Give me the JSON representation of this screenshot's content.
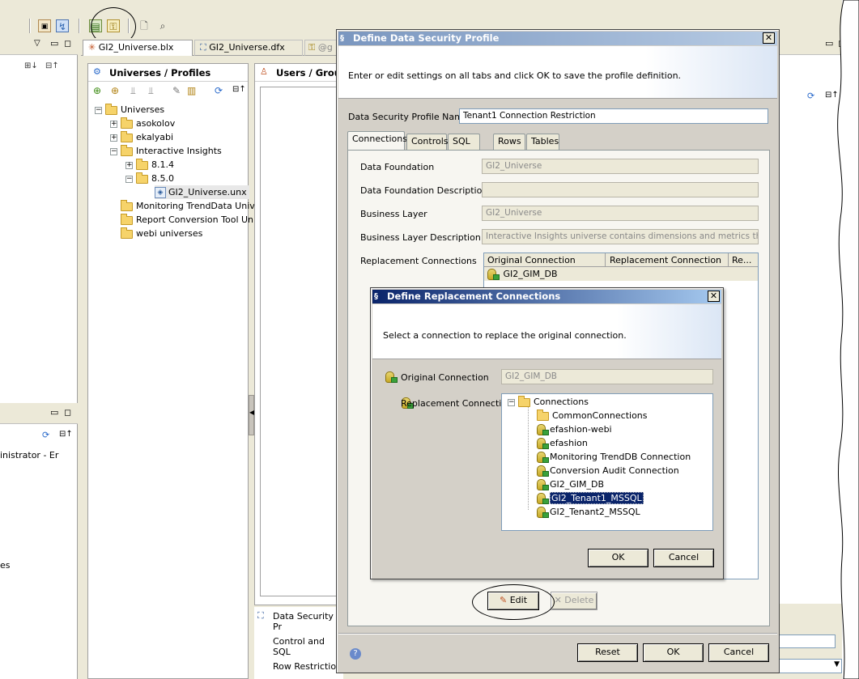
{
  "editor_tabs": [
    "GI2_Universe.blx",
    "GI2_Universe.dfx",
    "@g"
  ],
  "universes_panel": {
    "title": "Universes / Profiles",
    "tree": [
      {
        "label": "Universes",
        "level": 0,
        "expander": "-"
      },
      {
        "label": "asokolov",
        "level": 1,
        "expander": "+"
      },
      {
        "label": "ekalyabi",
        "level": 1,
        "expander": "+"
      },
      {
        "label": "Interactive Insights",
        "level": 1,
        "expander": "-"
      },
      {
        "label": "8.1.4",
        "level": 2,
        "expander": "+"
      },
      {
        "label": "8.5.0",
        "level": 2,
        "expander": "-"
      },
      {
        "label": "GI2_Universe.unx",
        "level": 3,
        "expander": ""
      },
      {
        "label": "Monitoring TrendData Unive",
        "level": 1,
        "expander": ""
      },
      {
        "label": "Report Conversion Tool Univ",
        "level": 1,
        "expander": ""
      },
      {
        "label": "webi universes",
        "level": 1,
        "expander": ""
      }
    ]
  },
  "users_panel": {
    "title": "Users / Group"
  },
  "left_panel": {
    "partial_text": "inistrator - Er",
    "partial_text2": "es"
  },
  "bottom_section": {
    "data_security_label": "Data Security Pr",
    "control_sql_label": "Control and SQL",
    "row_restriction_label": "Row Restriction"
  },
  "dsp_dialog": {
    "title": "Define Data Security Profile",
    "instructions": "Enter or edit settings on all tabs and click OK to save the profile definition.",
    "name_label": "Data Security Profile Name",
    "name_value": "Tenant1 Connection Restriction",
    "tabs": [
      "Connections",
      "Controls",
      "SQL",
      "Rows",
      "Tables"
    ],
    "fields": {
      "data_foundation_label": "Data Foundation",
      "data_foundation_value": "GI2_Universe",
      "df_description_label": "Data Foundation Description",
      "df_description_value": "",
      "business_layer_label": "Business Layer",
      "business_layer_value": "GI2_Universe",
      "bl_description_label": "Business Layer Description",
      "bl_description_value": "Interactive Insights universe contains dimensions and metrics that car",
      "replacement_label": "Replacement Connections"
    },
    "replacement_table": {
      "columns": [
        "Original Connection",
        "Replacement Connection",
        "Re..."
      ],
      "row_value": "GI2_GIM_DB"
    },
    "edit_button": "Edit",
    "delete_button": "Delete",
    "reset_button": "Reset",
    "ok_button": "OK",
    "cancel_button": "Cancel"
  },
  "drc_dialog": {
    "title": "Define Replacement Connections",
    "instructions": "Select a connection to replace the original connection.",
    "original_label": "Original Connection",
    "original_value": "GI2_GIM_DB",
    "replacement_label": "Replacement Connection",
    "tree_root": "Connections",
    "tree_items": [
      "CommonConnections",
      "efashion-webi",
      "efashion",
      "Monitoring TrendDB Connection",
      "Conversion Audit Connection",
      "GI2_GIM_DB",
      "GI2_Tenant1_MSSQL",
      "GI2_Tenant2_MSSQL"
    ],
    "selected_item": "GI2_Tenant1_MSSQL",
    "ok_button": "OK",
    "cancel_button": "Cancel"
  },
  "colors": {
    "titlebar_active": "#0a246a",
    "titlebar_gradient_end": "#a6caf0",
    "selection": "#0a246a",
    "window_bg": "#d4d0c8"
  }
}
